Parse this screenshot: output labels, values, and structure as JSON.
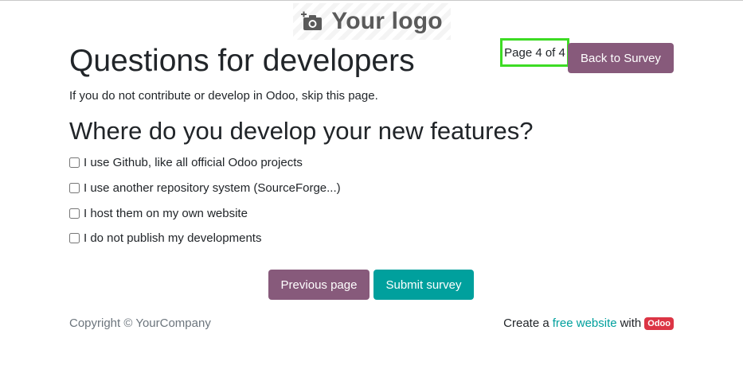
{
  "header": {
    "logo_text": "Your logo",
    "logo_icon": "camera-plus-icon"
  },
  "survey": {
    "title": "Questions for developers",
    "description": "If you do not contribute or develop in Odoo, skip this page.",
    "page_indicator": "Page 4 of 4",
    "back_button": "Back to Survey"
  },
  "question": {
    "title": "Where do you develop your new features?",
    "options": [
      {
        "label": "I use Github, like all official Odoo projects",
        "checked": false
      },
      {
        "label": "I use another repository system (SourceForge...)",
        "checked": false
      },
      {
        "label": "I host them on my own website",
        "checked": false
      },
      {
        "label": "I do not publish my developments",
        "checked": false
      }
    ]
  },
  "actions": {
    "previous": "Previous page",
    "submit": "Submit survey"
  },
  "footer": {
    "copyright": "Copyright © YourCompany",
    "create_prefix": "Create a",
    "link_text": "free website",
    "with_text": "with",
    "badge": "Odoo"
  },
  "colors": {
    "primary": "#875a7b",
    "secondary": "#00a09d",
    "badge": "#dc3545",
    "highlight": "#3ddc24"
  }
}
